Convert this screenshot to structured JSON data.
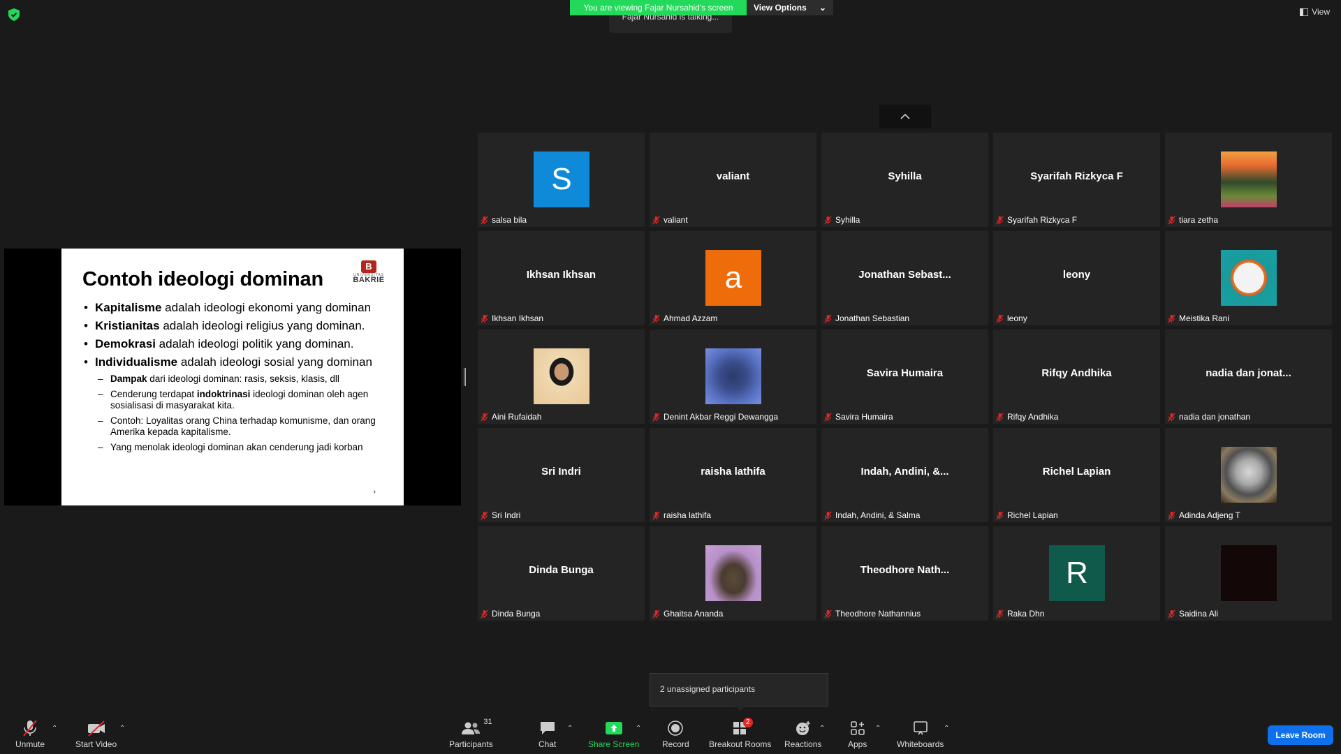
{
  "header": {
    "viewing_banner": "You are viewing Fajar Nursahid's screen",
    "view_options": "View Options",
    "talking": "Fajar Nursahid is talking...",
    "view_button": "View"
  },
  "slide": {
    "title": "Contoh ideologi dominan",
    "logo_uni": "UNIVERSITAS",
    "logo_name": "BAKRIE",
    "bullets": [
      {
        "bold": "Kapitalisme",
        "rest": " adalah ideologi ekonomi yang dominan"
      },
      {
        "bold": "Kristianitas",
        "rest": " adalah ideologi religius yang dominan."
      },
      {
        "bold": "Demokrasi",
        "rest": " adalah ideologi politik yang dominan."
      },
      {
        "bold": "Individualisme",
        "rest": " adalah ideologi sosial yang dominan"
      }
    ],
    "sub": [
      {
        "pre": "",
        "bold": "Dampak",
        "rest": " dari ideologi dominan: rasis, seksis, klasis, dll"
      },
      {
        "pre": "Cenderung terdapat ",
        "bold": "indoktrinasi",
        "rest": " ideologi dominan oleh agen sosialisasi di masyarakat kita."
      },
      {
        "pre": "Contoh: Loyalitas orang China terhadap komunisme, dan orang Amerika kepada kapitalisme.",
        "bold": "",
        "rest": ""
      },
      {
        "pre": "Yang menolak ideologi dominan akan cenderung jadi korban",
        "bold": "",
        "rest": ""
      }
    ],
    "arrow": "›"
  },
  "participants": [
    {
      "display": "S",
      "type": "letter",
      "bg": "#0e8ad8",
      "name": "salsa bila"
    },
    {
      "display": "valiant",
      "type": "text",
      "name": "valiant"
    },
    {
      "display": "Syhilla",
      "type": "text",
      "name": "Syhilla"
    },
    {
      "display": "Syarifah Rizkyca F",
      "type": "text",
      "name": "Syarifah Rizkyca F"
    },
    {
      "display": "",
      "type": "photo",
      "bg": "linear-gradient(180deg,#f0a040 0%,#e86a30 25%,#2f4a2a 55%,#6c8a3a 80%,#c0406a 100%)",
      "name": "tiara zetha"
    },
    {
      "display": "Ikhsan Ikhsan",
      "type": "text",
      "name": "Ikhsan Ikhsan"
    },
    {
      "display": "a",
      "type": "letter",
      "bg": "#ef6c0a",
      "name": "Ahmad Azzam"
    },
    {
      "display": "Jonathan Sebast...",
      "type": "text",
      "name": "Jonathan Sebastian"
    },
    {
      "display": "leony",
      "type": "text",
      "name": "leony"
    },
    {
      "display": "",
      "type": "photo",
      "bg": "radial-gradient(circle at 50% 50%,#f3f3f3 0%,#f3f3f3 38%,#e07a2a 39%,#d0602a 46%,#1a9a9a 47%,#17a0a6 100%)",
      "name": "Meistika Rani"
    },
    {
      "display": "",
      "type": "photo",
      "bg": "radial-gradient(ellipse at 50% 42%,#c99a72 0%,#c99a72 18%,#1a1a1a 19%,#1a1a1a 30%,#f0d8b0 31%,#e8c898 100%)",
      "name": "Aini Rufaidah"
    },
    {
      "display": "",
      "type": "photo",
      "bg": "radial-gradient(circle at 50% 50%,#2a3a6a 0%,#3a4c8a 35%,#5b74c6 70%,#7a8ee0 100%)",
      "name": "Denint Akbar Reggi Dewangga"
    },
    {
      "display": "Savira Humaira",
      "type": "text",
      "name": "Savira Humaira"
    },
    {
      "display": "Rifqy Andhika",
      "type": "text",
      "name": "Rifqy Andhika"
    },
    {
      "display": "nadia dan jonat...",
      "type": "text",
      "name": "nadia dan jonathan"
    },
    {
      "display": "Sri Indri",
      "type": "text",
      "name": "Sri Indri"
    },
    {
      "display": "raisha lathifa",
      "type": "text",
      "name": "raisha lathifa"
    },
    {
      "display": "Indah,  Andini, &...",
      "type": "text",
      "name": "Indah, Andini, & Salma"
    },
    {
      "display": "Richel Lapian",
      "type": "text",
      "name": "Richel Lapian"
    },
    {
      "display": "",
      "type": "photo",
      "bg": "radial-gradient(circle at 50% 45%,#d8d8d8 0%,#a8a8a8 30%,#505050 55%,#8a7a60 75%,#3a2a1a 100%)",
      "name": "Adinda Adjeng T"
    },
    {
      "display": "Dinda Bunga",
      "type": "text",
      "name": "Dinda Bunga"
    },
    {
      "display": "",
      "type": "photo",
      "bg": "radial-gradient(ellipse at 50% 60%,#5a4a3a 0%,#4a3c30 30%,#b890c8 60%,#c8a0d8 100%)",
      "name": "Ghaitsa Ananda"
    },
    {
      "display": "Theodhore  Nath...",
      "type": "text",
      "name": "Theodhore Nathannius"
    },
    {
      "display": "R",
      "type": "letter",
      "bg": "#0f5a4a",
      "name": "Raka Dhn"
    },
    {
      "display": "",
      "type": "photo",
      "bg": "#140708",
      "name": "Saidina Ali"
    }
  ],
  "tooltip": {
    "text": "2 unassigned participants"
  },
  "toolbar": {
    "unmute": "Unmute",
    "start_video": "Start Video",
    "participants": "Participants",
    "participants_count": "31",
    "chat": "Chat",
    "share_screen": "Share Screen",
    "record": "Record",
    "breakout_rooms": "Breakout Rooms",
    "breakout_badge": "2",
    "reactions": "Reactions",
    "apps": "Apps",
    "whiteboards": "Whiteboards",
    "leave": "Leave Room"
  },
  "colors": {
    "share_green": "#23d959",
    "leave_blue": "#0e71eb",
    "muted_red": "#e02828"
  }
}
